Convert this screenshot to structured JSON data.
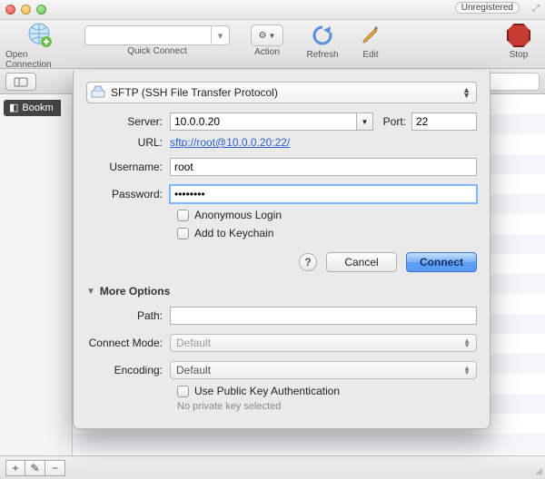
{
  "window": {
    "unregistered_badge": "Unregistered"
  },
  "toolbar": {
    "open_connection": "Open Connection",
    "quick_connect": "Quick Connect",
    "action": "Action",
    "refresh": "Refresh",
    "edit": "Edit",
    "stop": "Stop"
  },
  "sidebar": {
    "bookmarks_tab": "Bookm"
  },
  "bottom": {
    "add": "+",
    "edit": "✎",
    "remove": "−"
  },
  "sheet": {
    "protocol_label": "SFTP (SSH File Transfer Protocol)",
    "server_label": "Server:",
    "server_value": "10.0.0.20",
    "port_label": "Port:",
    "port_value": "22",
    "url_label": "URL:",
    "url_value": "sftp://root@10.0.0.20:22/",
    "username_label": "Username:",
    "username_value": "root",
    "password_label": "Password:",
    "password_value": "••••••••",
    "anonymous_label": "Anonymous Login",
    "keychain_label": "Add to Keychain",
    "help_label": "?",
    "cancel_label": "Cancel",
    "connect_label": "Connect",
    "more_options_label": "More Options",
    "path_label": "Path:",
    "path_value": "",
    "connect_mode_label": "Connect Mode:",
    "connect_mode_value": "Default",
    "encoding_label": "Encoding:",
    "encoding_value": "Default",
    "pubkey_label": "Use Public Key Authentication",
    "pubkey_hint": "No private key selected"
  }
}
